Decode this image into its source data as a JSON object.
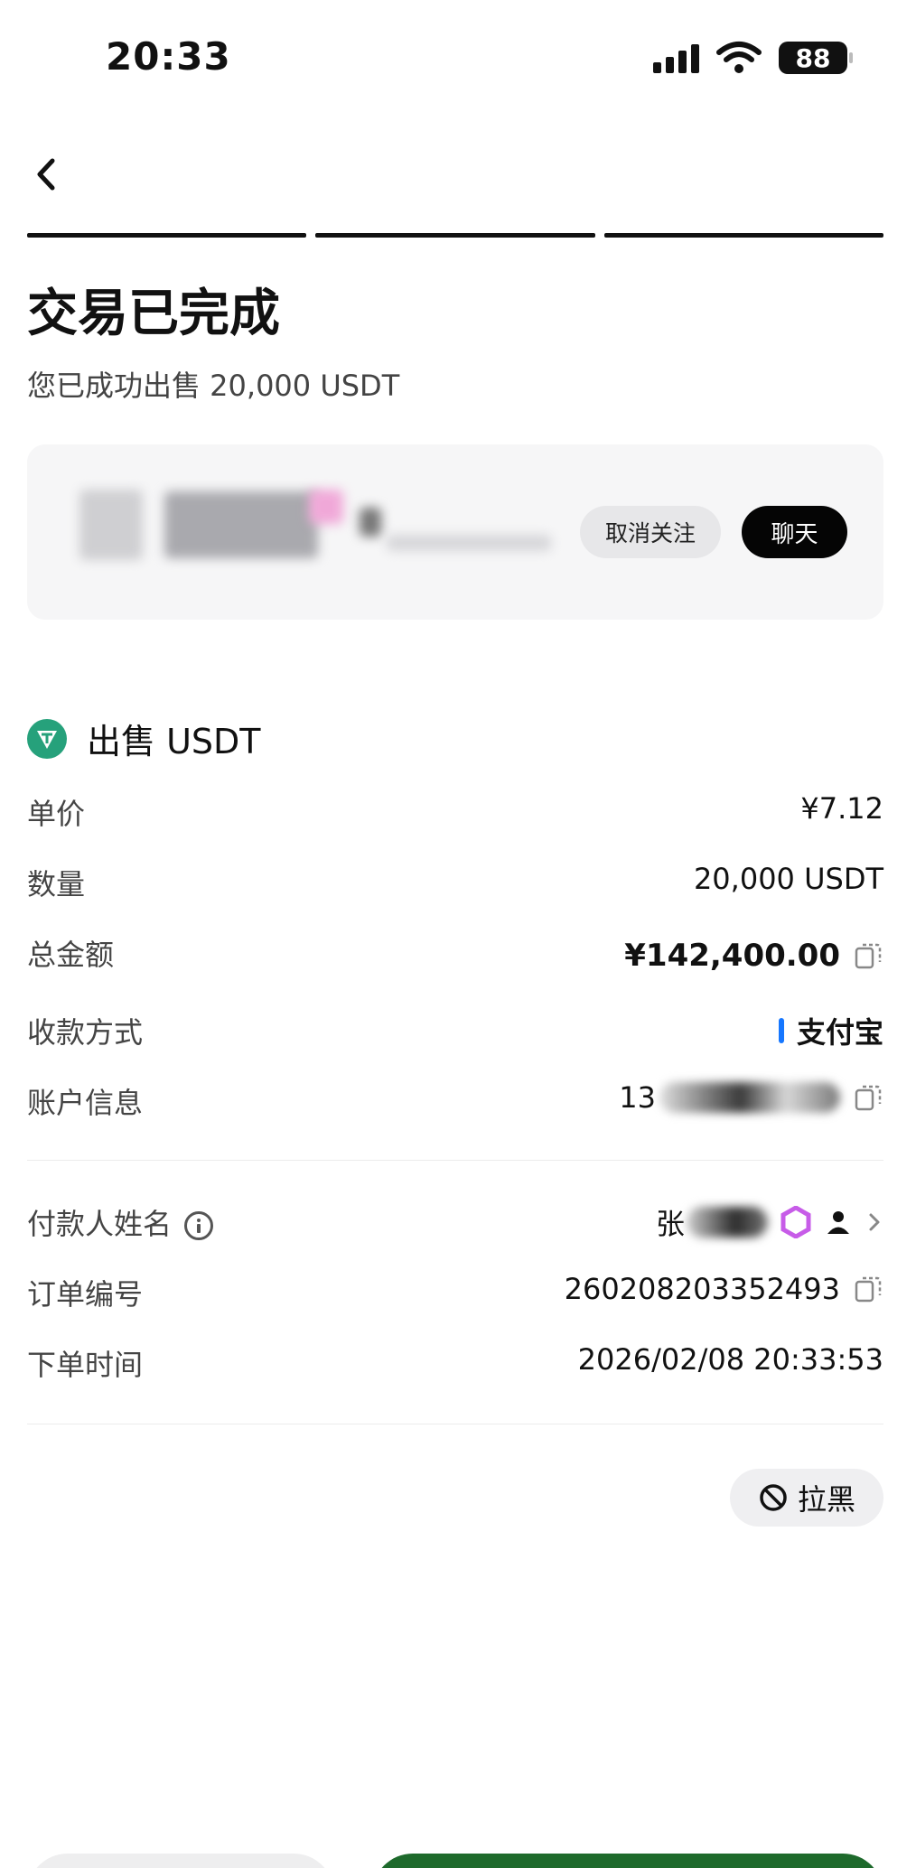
{
  "status_bar": {
    "time": "20:33",
    "battery": "88"
  },
  "header": {
    "progress_steps": 3
  },
  "page": {
    "title": "交易已完成",
    "subtitle": "您已成功出售 20,000 USDT"
  },
  "counterparty": {
    "unfollow_label": "取消关注",
    "chat_label": "聊天"
  },
  "order": {
    "section_title": "出售 USDT",
    "rows": [
      {
        "label": "单价",
        "value": "¥7.12"
      },
      {
        "label": "数量",
        "value": "20,000 USDT"
      },
      {
        "label": "总金额",
        "value": "¥142,400.00"
      },
      {
        "label": "收款方式",
        "value": "支付宝"
      },
      {
        "label": "账户信息",
        "value": "13"
      }
    ],
    "details": [
      {
        "label": "付款人姓名",
        "value": "张"
      },
      {
        "label": "订单编号",
        "value": "260208203352493"
      },
      {
        "label": "下单时间",
        "value": "2026/02/08 20:33:53"
      }
    ]
  },
  "actions": {
    "block_label": "拉黑"
  },
  "colors": {
    "usdt": "#26a17b",
    "alipay": "#1677ff",
    "primary_button": "#1e6a2c"
  }
}
